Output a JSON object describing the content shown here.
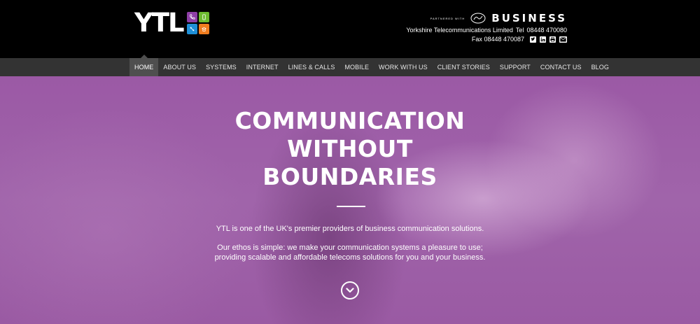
{
  "header": {
    "logo_text": "YTL",
    "partner_small": "PARTNERED WITH",
    "partner_business": "BUSINESS",
    "company_line": "Yorkshire Telecommunications Limited",
    "tel_label": "Tel",
    "tel_number": "08448 470080",
    "fax_label": "Fax",
    "fax_number": "08448 470087",
    "social_icons": [
      "twitter-icon",
      "linkedin-icon",
      "printer-icon",
      "email-icon"
    ]
  },
  "nav": {
    "items": [
      {
        "label": "HOME"
      },
      {
        "label": "ABOUT US"
      },
      {
        "label": "SYSTEMS"
      },
      {
        "label": "INTERNET"
      },
      {
        "label": "LINES & CALLS"
      },
      {
        "label": "MOBILE"
      },
      {
        "label": "WORK WITH US"
      },
      {
        "label": "CLIENT STORIES"
      },
      {
        "label": "SUPPORT"
      },
      {
        "label": "CONTACT US"
      },
      {
        "label": "BLOG"
      }
    ],
    "active": "HOME"
  },
  "hero": {
    "title_lines": [
      "COMMUNICATION",
      "WITHOUT",
      "BOUNDARIES"
    ],
    "paragraph1": "YTL is one of the UK's premier providers of business communication solutions.",
    "paragraph2": "Our ethos is simple: we make your communication systems a pleasure to use; providing scalable and affordable telecoms solutions for you and your business."
  },
  "colors": {
    "header_bg": "#000000",
    "nav_bg": "#333333",
    "nav_active_bg": "#4f4f4f",
    "hero_tint": "#9b59a5",
    "logo_purple": "#8e3fa6",
    "logo_green": "#6dbb2f",
    "logo_blue": "#1f8fd6",
    "logo_orange": "#f07d1f"
  }
}
